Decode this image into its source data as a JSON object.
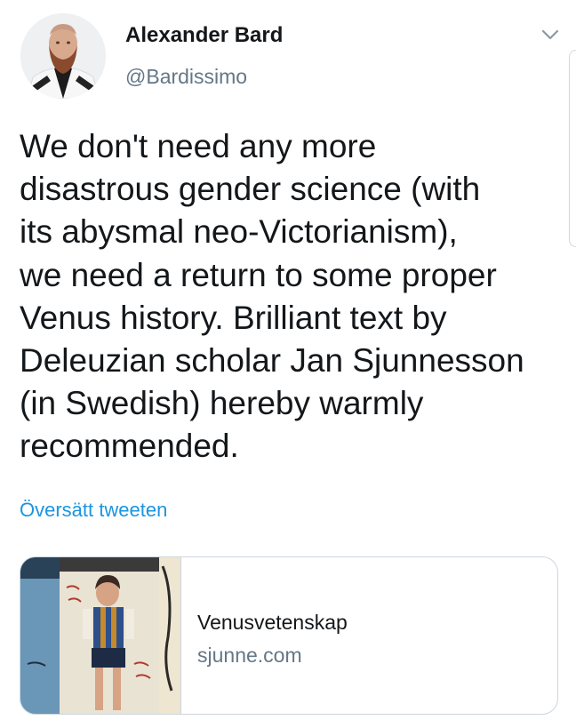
{
  "author": {
    "display_name": "Alexander Bard",
    "handle": "@Bardissimo"
  },
  "tweet": {
    "lines": [
      "We don't need any more",
      "disastrous gender science (with",
      "its abysmal neo-Victorianism),",
      "we need a return to some proper",
      "Venus history. Brilliant text by",
      "Deleuzian scholar Jan Sjunnesson",
      "(in Swedish) hereby warmly",
      "recommended."
    ]
  },
  "translate_link": "Översätt tweeten",
  "link_card": {
    "title": "Venusvetenskap",
    "domain": "sjunne.com"
  },
  "icons": {
    "menu": "chevron-down-icon"
  },
  "colors": {
    "link": "#1b95e0",
    "secondary_text": "#657786",
    "border": "#ccd6dd"
  }
}
